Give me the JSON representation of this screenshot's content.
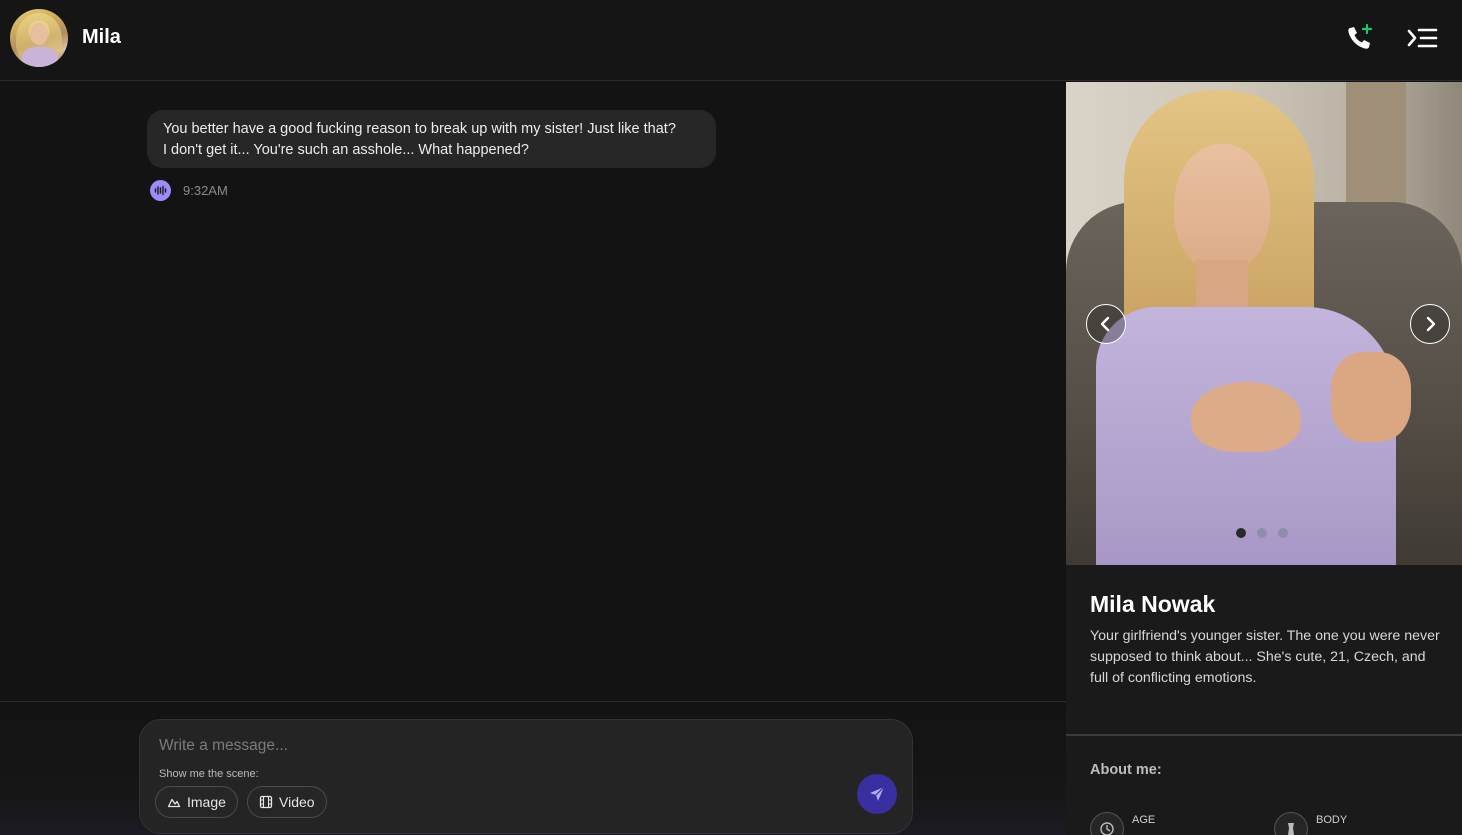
{
  "header": {
    "name": "Mila",
    "call_icon": "phone-plus-icon",
    "menu_icon": "collapse-menu-icon"
  },
  "chat": {
    "messages": [
      {
        "lines": [
          "You better have a good fucking reason to break up with my sister! Just like that?",
          "I don't get it... You're such an asshole... What happened?"
        ],
        "time": "9:32AM",
        "voice_icon": "voice-wave-icon"
      }
    ]
  },
  "composer": {
    "placeholder": "Write a message...",
    "scene_label": "Show me the scene:",
    "image_label": "Image",
    "video_label": "Video",
    "send_icon": "send-icon"
  },
  "profile": {
    "name": "Mila Nowak",
    "description": "Your girlfriend's younger sister. The one you were never supposed to think about... She's cute, 21, Czech, and full of conflicting emotions.",
    "carousel_total": 3,
    "carousel_active": 1,
    "about_title": "About me:",
    "attributes": [
      {
        "label": "AGE"
      },
      {
        "label": "BODY"
      }
    ]
  },
  "colors": {
    "accent": "#9b8cf7",
    "send_button": "#3a2fa0",
    "call_plus": "#22c55e",
    "background": "#131313"
  }
}
